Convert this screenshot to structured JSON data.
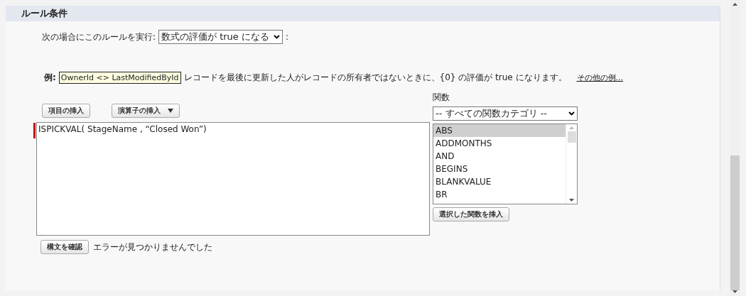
{
  "section": {
    "title": "ルール条件"
  },
  "run_rule": {
    "label": "次の場合にこのルールを実行:",
    "value": "数式の評価が true になる",
    "suffix": ":"
  },
  "example": {
    "label": "例:",
    "code": "OwnerId <> LastModifiedById",
    "text": "レコードを最後に更新した人がレコードの所有者ではないときに、{0} の評価が true になります。",
    "link": "その他の例..."
  },
  "toolbar": [
    {
      "label": "項目の挿入",
      "kind": "button"
    },
    {
      "label": "演算子の挿入",
      "kind": "menu"
    }
  ],
  "formula": {
    "value": "ISPICKVAL( StageName , “Closed Won”)",
    "required": true
  },
  "check": {
    "label": "構文を確認",
    "message": "エラーが見つかりませんでした"
  },
  "functions": {
    "label": "関数",
    "category": "-- すべての関数カテゴリ --",
    "items": [
      {
        "name": "ABS",
        "selected": true
      },
      {
        "name": "ADDMONTHS",
        "selected": false
      },
      {
        "name": "AND",
        "selected": false
      },
      {
        "name": "BEGINS",
        "selected": false
      },
      {
        "name": "BLANKVALUE",
        "selected": false
      },
      {
        "name": "BR",
        "selected": false
      }
    ],
    "insert": "選択した関数を挿入"
  }
}
